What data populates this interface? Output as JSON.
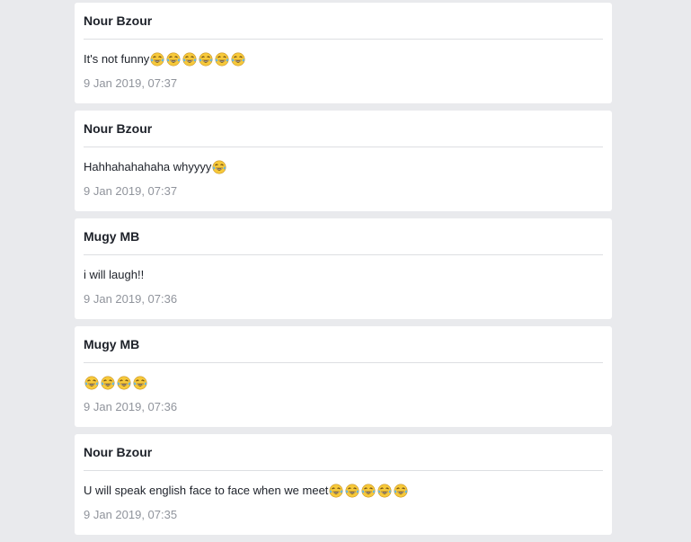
{
  "messages": [
    {
      "sender": "Nour Bzour",
      "text": "It's not funny",
      "emojis": [
        "joy-emoji-icon",
        "joy-emoji-icon",
        "joy-emoji-icon",
        "joy-emoji-icon",
        "joy-emoji-icon",
        "joy-emoji-icon"
      ],
      "timestamp": "9 Jan 2019, 07:37"
    },
    {
      "sender": "Nour Bzour",
      "text": "Hahhahahahaha whyyyy",
      "emojis": [
        "joy-emoji-icon"
      ],
      "timestamp": "9 Jan 2019, 07:37"
    },
    {
      "sender": "Mugy MB",
      "text": "i will laugh!!",
      "emojis": [],
      "timestamp": "9 Jan 2019, 07:36"
    },
    {
      "sender": "Mugy MB",
      "text": "",
      "emojis": [
        "joy-emoji-icon",
        "joy-emoji-icon",
        "joy-emoji-icon",
        "joy-emoji-icon"
      ],
      "timestamp": "9 Jan 2019, 07:36"
    },
    {
      "sender": "Nour Bzour",
      "text": "U will speak english face to face when we meet",
      "emojis": [
        "joy-emoji-icon",
        "joy-emoji-icon",
        "joy-emoji-icon",
        "joy-emoji-icon",
        "joy-emoji-icon"
      ],
      "timestamp": "9 Jan 2019, 07:35"
    }
  ],
  "colors": {
    "page_background": "#e9eaed",
    "card_background": "#ffffff",
    "sender_text": "#1d2129",
    "timestamp_text": "#90949c",
    "divider": "#dddfe2",
    "emoji_face": "#f7c93a"
  }
}
